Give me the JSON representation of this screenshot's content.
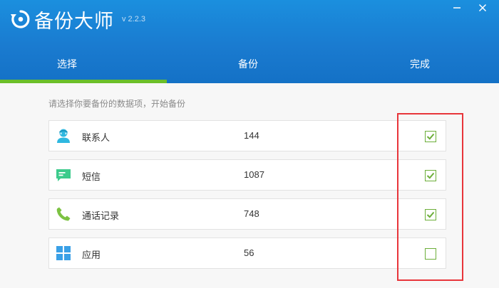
{
  "app": {
    "title": "备份大师",
    "version": "v 2.2.3",
    "logo_icon": "backup-refresh-icon",
    "accent_color": "#1a7bd0",
    "tab_indicator_color": "#6cbf29"
  },
  "window": {
    "minimize_icon": "minimize-icon",
    "close_icon": "close-icon"
  },
  "tabs": [
    {
      "label": "选择",
      "active": true
    },
    {
      "label": "备份",
      "active": false
    },
    {
      "label": "完成",
      "active": false
    }
  ],
  "hint": "请选择你要备份的数据项，开始备份",
  "items": [
    {
      "label": "联系人",
      "count": "144",
      "icon": "contact-icon",
      "icon_color": "#2fb8e0",
      "checked": true
    },
    {
      "label": "短信",
      "count": "1087",
      "icon": "message-icon",
      "icon_color": "#3ccb8c",
      "checked": true
    },
    {
      "label": "通话记录",
      "count": "748",
      "icon": "phone-icon",
      "icon_color": "#7cc242",
      "checked": true
    },
    {
      "label": "应用",
      "count": "56",
      "icon": "apps-icon",
      "icon_color": "#3aa0e6",
      "checked": false
    }
  ],
  "checkbox_color": "#6cae39",
  "highlight_color": "#e8353a"
}
